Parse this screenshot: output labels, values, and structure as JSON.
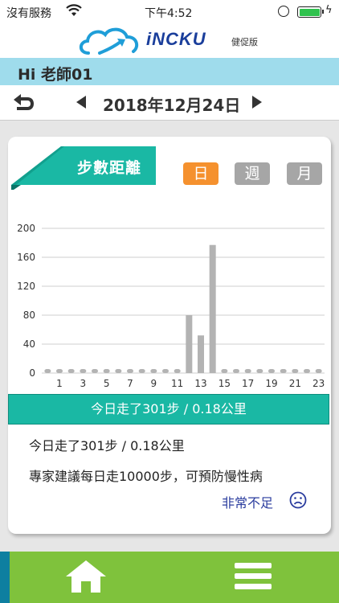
{
  "status_bar": {
    "carrier": "沒有服務",
    "time": "下午4:52",
    "battery_level": 1.0
  },
  "brand": {
    "logo_text": "iNCKU",
    "logo_sub": "健促版"
  },
  "greeting": "Hi 老師01",
  "date_nav": {
    "date": "2018年12月24日"
  },
  "card": {
    "title": "步數距離",
    "tabs": {
      "day": "日",
      "week": "週",
      "month": "月"
    },
    "active_tab": "day"
  },
  "chart_data": {
    "type": "bar",
    "x": [
      0,
      1,
      2,
      3,
      4,
      5,
      6,
      7,
      8,
      9,
      10,
      11,
      12,
      13,
      14,
      15,
      16,
      17,
      18,
      19,
      20,
      21,
      22,
      23
    ],
    "x_tick_labels": [
      "1",
      "3",
      "5",
      "7",
      "9",
      "11",
      "13",
      "15",
      "17",
      "19",
      "21",
      "23"
    ],
    "values": [
      0,
      0,
      0,
      0,
      0,
      0,
      0,
      0,
      0,
      0,
      0,
      0,
      80,
      52,
      177,
      0,
      0,
      0,
      0,
      0,
      0,
      0,
      0,
      0
    ],
    "ylim": [
      0,
      200
    ],
    "y_ticks": [
      "0",
      "40",
      "80",
      "120",
      "160",
      "200"
    ],
    "grid": true,
    "bar_color": "#b3b3b3",
    "title": "",
    "xlabel": "",
    "ylabel": ""
  },
  "summary": {
    "bar_text": "今日走了301步 / 0.18公里",
    "line1": "今日走了301步 / 0.18公里",
    "line2": "專家建議每日走10000步，可預防慢性病",
    "status_text": "非常不足",
    "status_icon": "sad-face-icon"
  },
  "bottom_nav": {
    "home_icon": "home-icon",
    "menu_icon": "hamburger-menu-icon"
  },
  "colors": {
    "header_bar": "#9fdcec",
    "teal": "#1ab8a4",
    "orange_tab": "#f5912e",
    "grey_tab": "#a6a6a6",
    "bottom_green": "#7fc23c",
    "status_blue": "#2a3c9e"
  }
}
